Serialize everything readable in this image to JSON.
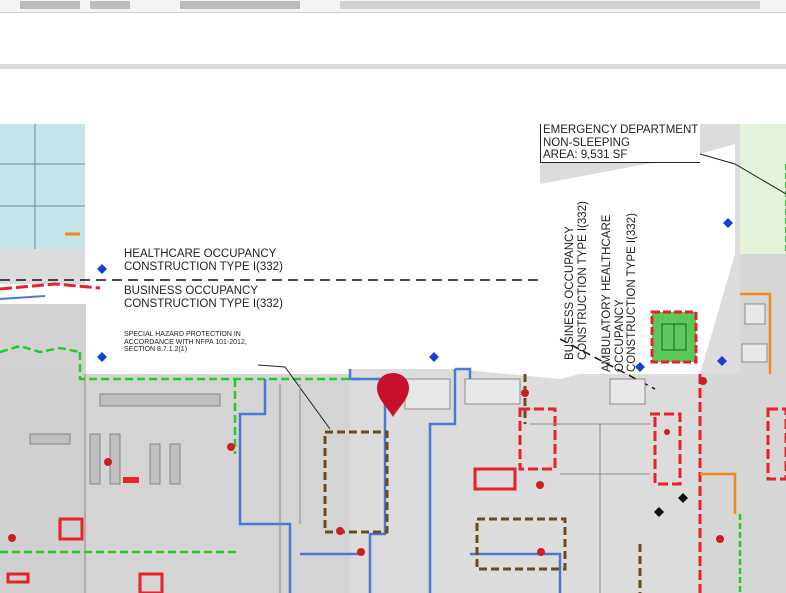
{
  "labels": {
    "emergency_line1": "EMERGENCY DEPARTMENT",
    "emergency_line2": "NON-SLEEPING",
    "emergency_line3": "AREA: 9,531 SF",
    "healthcare_line1": "HEALTHCARE OCCUPANCY",
    "healthcare_line2": "CONSTRUCTION TYPE I(332)",
    "business_line1": "BUSINESS OCCUPANCY",
    "business_line2": "CONSTRUCTION TYPE I(332)",
    "hazard_line1": "SPECIAL HAZARD PROTECTION IN",
    "hazard_line2": "ACCORDANCE WITH NFPA 101-2012,",
    "hazard_line3": "SECTION 8.7.1.2(1)",
    "vertical_business_line1": "BUSINESS OCCUPANCY",
    "vertical_business_line2": "CONSTRUCTION TYPE I(332)",
    "vertical_ambulatory_line1": "AMBULATORY HEALTHCARE",
    "vertical_ambulatory_line2": "OCCUPANCY",
    "vertical_ambulatory_line3": "CONSTRUCTION TYPE I(332)"
  },
  "colors": {
    "fire_barrier_red": "#e8212a",
    "smoke_green": "#22cc22",
    "suite_blue": "#4a78d2",
    "hazard_brown": "#6b4a1e",
    "marker_red": "#cc1f22",
    "stair_green": "#5cc85c",
    "patient_rooms_teal": "#c7e3ea",
    "diamond_blue": "#1a3fd6",
    "orange_boundary": "#f08a1c"
  },
  "icons": {
    "location_pin": "map-marker-icon",
    "fire_extinguisher": "circle-dot-icon",
    "fire_alarm": "diamond-icon"
  }
}
